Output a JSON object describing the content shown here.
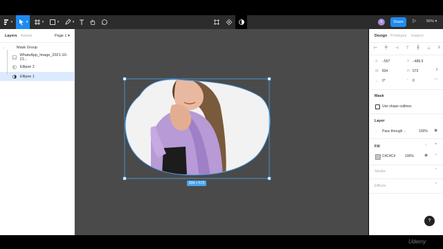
{
  "toolbar": {
    "share_label": "Share",
    "avatar_initial": "A",
    "zoom_label": "56%"
  },
  "left_panel": {
    "tabs": [
      "Layers",
      "Assets"
    ],
    "page_label": "Page 1",
    "layers": [
      {
        "name": "Mask Group",
        "icon": "mask-group-icon",
        "selected": false
      },
      {
        "name": "WhatsApp_Image_2021-10-21...",
        "icon": "image-icon",
        "selected": false
      },
      {
        "name": "Ellipse 2",
        "icon": "ellipse-icon",
        "selected": false
      },
      {
        "name": "Ellipse 1",
        "icon": "ellipse-mask-icon",
        "selected": true
      }
    ]
  },
  "canvas": {
    "size_badge": "834 × 573",
    "selection_color": "#4aa3f0",
    "background": "#4a4a4a"
  },
  "right_panel": {
    "tabs": [
      "Design",
      "Prototype",
      "Inspect"
    ],
    "x_value": "−557",
    "y_value": "−486.5",
    "w_value": "834",
    "h_value": "573",
    "rotation_value": "0°",
    "radius_value": "0",
    "x_label": "X",
    "y_label": "Y",
    "w_label": "W",
    "h_label": "H",
    "mask_title": "Mask",
    "mask_checkbox_label": "Use shape outlines",
    "layer_title": "Layer",
    "blend_mode": "Pass through",
    "layer_opacity": "100%",
    "fill_title": "Fill",
    "fill_hex": "C4C4C4",
    "fill_opacity": "100%",
    "fill_color": "#C4C4C4",
    "stroke_title": "Stroke",
    "effects_title": "Effects"
  },
  "help_label": "?",
  "watermark": "Udemy"
}
